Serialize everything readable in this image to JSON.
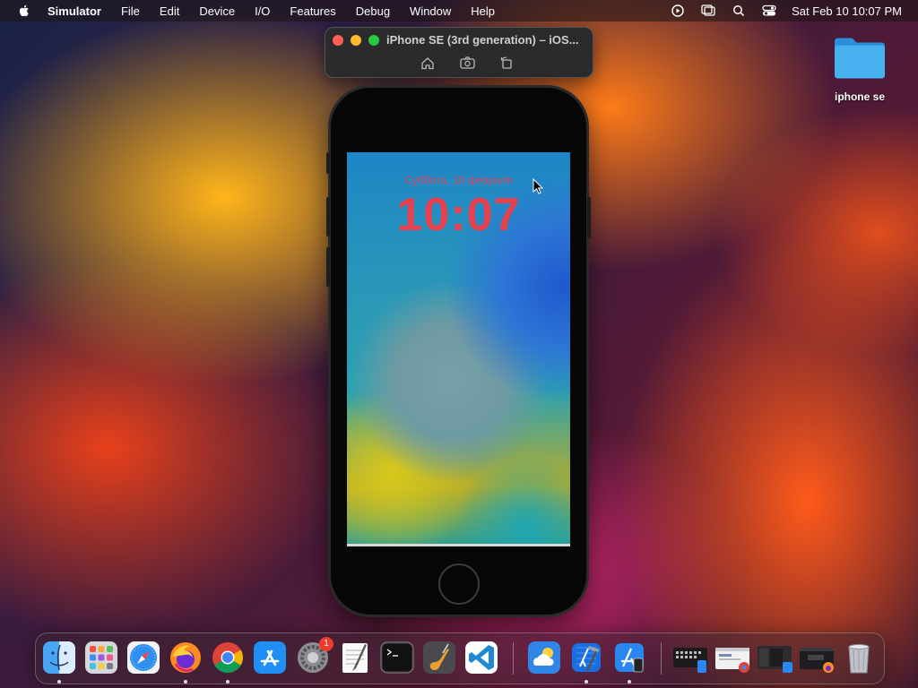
{
  "menubar": {
    "app_name": "Simulator",
    "menus": [
      "File",
      "Edit",
      "Device",
      "I/O",
      "Features",
      "Debug",
      "Window",
      "Help"
    ],
    "clock": "Sat Feb 10  10:07 PM"
  },
  "desktop": {
    "folder_label": "iphone se"
  },
  "simulator": {
    "window_title": "iPhone SE (3rd generation) – iOS...",
    "traffic_colors": {
      "close": "#ff5f57",
      "minimize": "#febc2e",
      "zoom": "#28c840"
    }
  },
  "lockscreen": {
    "date": "Суббота, 10 февраля",
    "time": "10:07",
    "time_color": "#e7414f"
  },
  "dock": {
    "apps": [
      {
        "name": "Finder",
        "icon": "finder-icon",
        "running": true
      },
      {
        "name": "Launchpad",
        "icon": "launchpad-icon",
        "running": false
      },
      {
        "name": "Safari",
        "icon": "safari-icon",
        "running": false
      },
      {
        "name": "Firefox",
        "icon": "firefox-icon",
        "running": true
      },
      {
        "name": "Chrome",
        "icon": "chrome-icon",
        "running": true
      },
      {
        "name": "App Store",
        "icon": "app-store-icon",
        "running": false
      },
      {
        "name": "System Settings",
        "icon": "settings-icon",
        "running": false,
        "badge": "1"
      },
      {
        "name": "TextEdit",
        "icon": "textedit-icon",
        "running": false
      },
      {
        "name": "Terminal",
        "icon": "terminal-icon",
        "running": false
      },
      {
        "name": "GarageBand",
        "icon": "garageband-icon",
        "running": false
      },
      {
        "name": "VS Code",
        "icon": "vscode-icon",
        "running": false
      },
      {
        "name": "Weather",
        "icon": "weather-icon",
        "running": false
      },
      {
        "name": "Xcode",
        "icon": "xcode-icon",
        "running": true
      },
      {
        "name": "Simulator",
        "icon": "simulator-icon",
        "running": true
      }
    ],
    "recent": [
      {
        "name": "Keyboard Window",
        "icon": "minimized-window-icon"
      },
      {
        "name": "Chrome Window",
        "icon": "minimized-window-icon"
      },
      {
        "name": "Xcode Window",
        "icon": "minimized-window-icon"
      },
      {
        "name": "Firefox Window",
        "icon": "minimized-window-icon"
      }
    ],
    "trash": {
      "name": "Trash",
      "icon": "trash-icon"
    }
  }
}
